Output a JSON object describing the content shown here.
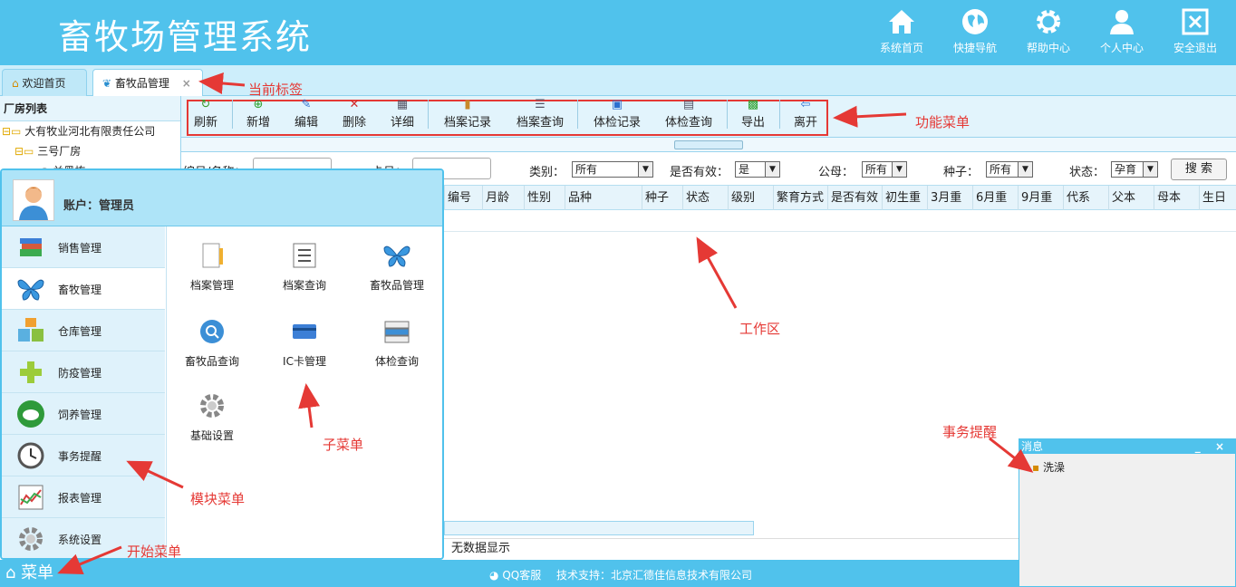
{
  "header": {
    "title": "畜牧场管理系统",
    "nav": [
      {
        "label": "系统首页",
        "icon": "home-icon"
      },
      {
        "label": "快捷导航",
        "icon": "globe-icon"
      },
      {
        "label": "帮助中心",
        "icon": "gear-icon"
      },
      {
        "label": "个人中心",
        "icon": "user-icon"
      },
      {
        "label": "安全退出",
        "icon": "logout-icon"
      }
    ]
  },
  "tabs": [
    {
      "label": "欢迎首页",
      "icon": "home-icon"
    },
    {
      "label": "畜牧品管理",
      "icon": "butterfly-icon",
      "close": "×"
    }
  ],
  "tree": {
    "title": "厂房列表",
    "nodes": [
      "大有牧业河北有限责任公司",
      "三号厂房",
      "兰黑栋"
    ]
  },
  "toolbar": {
    "buttons": [
      "刷新",
      "新增",
      "编辑",
      "删除",
      "详细",
      "档案记录",
      "档案查询",
      "体检记录",
      "体检查询",
      "导出",
      "离开"
    ]
  },
  "filters": {
    "name_label": "编号/名称：",
    "card_label": "卡号：",
    "category_label": "类别：",
    "category_value": "所有",
    "valid_label": "是否有效：",
    "valid_value": "是",
    "sire_label": "公母：",
    "sire_value": "所有",
    "breed_label": "种子：",
    "breed_value": "所有",
    "status_label": "状态：",
    "status_value": "孕育",
    "search_label": "搜 索"
  },
  "grid": {
    "columns": [
      "编号",
      "月龄",
      "性别",
      "品种",
      "种子",
      "状态",
      "级别",
      "繁育方式",
      "是否有效",
      "初生重",
      "3月重",
      "6月重",
      "9月重",
      "代系",
      "父本",
      "母本",
      "生日"
    ],
    "empty_text": "无数据显示"
  },
  "start_menu": {
    "account": "账户：管理员",
    "modules": [
      {
        "label": "销售管理",
        "icon": "books-icon"
      },
      {
        "label": "畜牧管理",
        "icon": "butterfly-icon"
      },
      {
        "label": "仓库管理",
        "icon": "boxes-icon"
      },
      {
        "label": "防疫管理",
        "icon": "plus-icon"
      },
      {
        "label": "饲养管理",
        "icon": "sheep-icon"
      },
      {
        "label": "事务提醒",
        "icon": "clock-icon"
      },
      {
        "label": "报表管理",
        "icon": "chart-icon"
      },
      {
        "label": "系统设置",
        "icon": "gear-icon"
      }
    ],
    "submenu": [
      {
        "label": "档案管理",
        "icon": "notebook-icon"
      },
      {
        "label": "档案查询",
        "icon": "list-icon"
      },
      {
        "label": "畜牧品管理",
        "icon": "butterfly-icon"
      },
      {
        "label": "畜牧品查询",
        "icon": "magnifier-icon"
      },
      {
        "label": "IC卡管理",
        "icon": "card-icon"
      },
      {
        "label": "体检查询",
        "icon": "items-icon"
      },
      {
        "label": "基础设置",
        "icon": "gear-icon"
      }
    ]
  },
  "messages": {
    "title": "消息",
    "controls": "_ ×",
    "items": [
      "洗澡"
    ]
  },
  "footer": {
    "menu_label": "菜单",
    "qq_label": "QQ客服",
    "tech_support": "技术支持：北京汇德佳信息技术有限公司"
  },
  "annotations": {
    "current_tab": "当前标签",
    "function_menu": "功能菜单",
    "work_area": "工作区",
    "reminder": "事务提醒",
    "submenu": "子菜单",
    "module_menu": "模块菜单",
    "start_menu": "开始菜单"
  },
  "colors": {
    "accent": "#50c2ec",
    "annotation": "#e53935"
  }
}
